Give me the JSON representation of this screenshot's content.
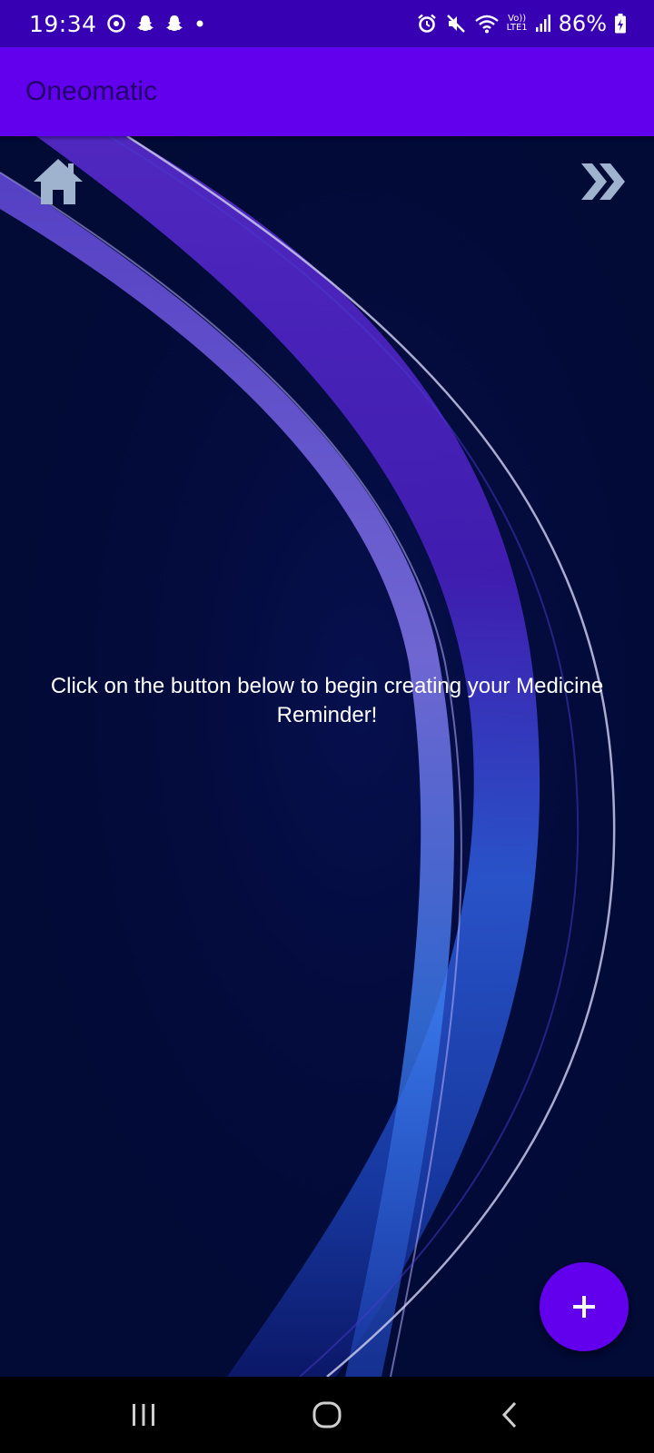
{
  "status_bar": {
    "time": "19:34",
    "battery": "86%",
    "network_label": "Vo))\nLTE1",
    "left_icons": [
      "sync-icon",
      "snapchat-icon",
      "snapchat-icon",
      "dot-icon"
    ],
    "right_icons": [
      "alarm-icon",
      "mute-icon",
      "wifi-icon",
      "signal-icon",
      "battery-charging-icon"
    ]
  },
  "app_bar": {
    "title": "Oneomatic"
  },
  "toolbar": {
    "home_icon": "home-icon",
    "next_icon": "double-chevron-right-icon"
  },
  "main": {
    "message": "Click on the button below to begin creating your Medicine Reminder!"
  },
  "fab": {
    "icon": "plus-icon"
  },
  "nav_bar": {
    "buttons": [
      "recents-icon",
      "home-circle-icon",
      "back-icon"
    ]
  },
  "colors": {
    "status_bar": "#3700b3",
    "app_bar": "#6200ee",
    "title_text": "#24006b",
    "background": "#020a36",
    "fab": "#6200ee",
    "toolbar_icon": "#9fb3cf"
  }
}
